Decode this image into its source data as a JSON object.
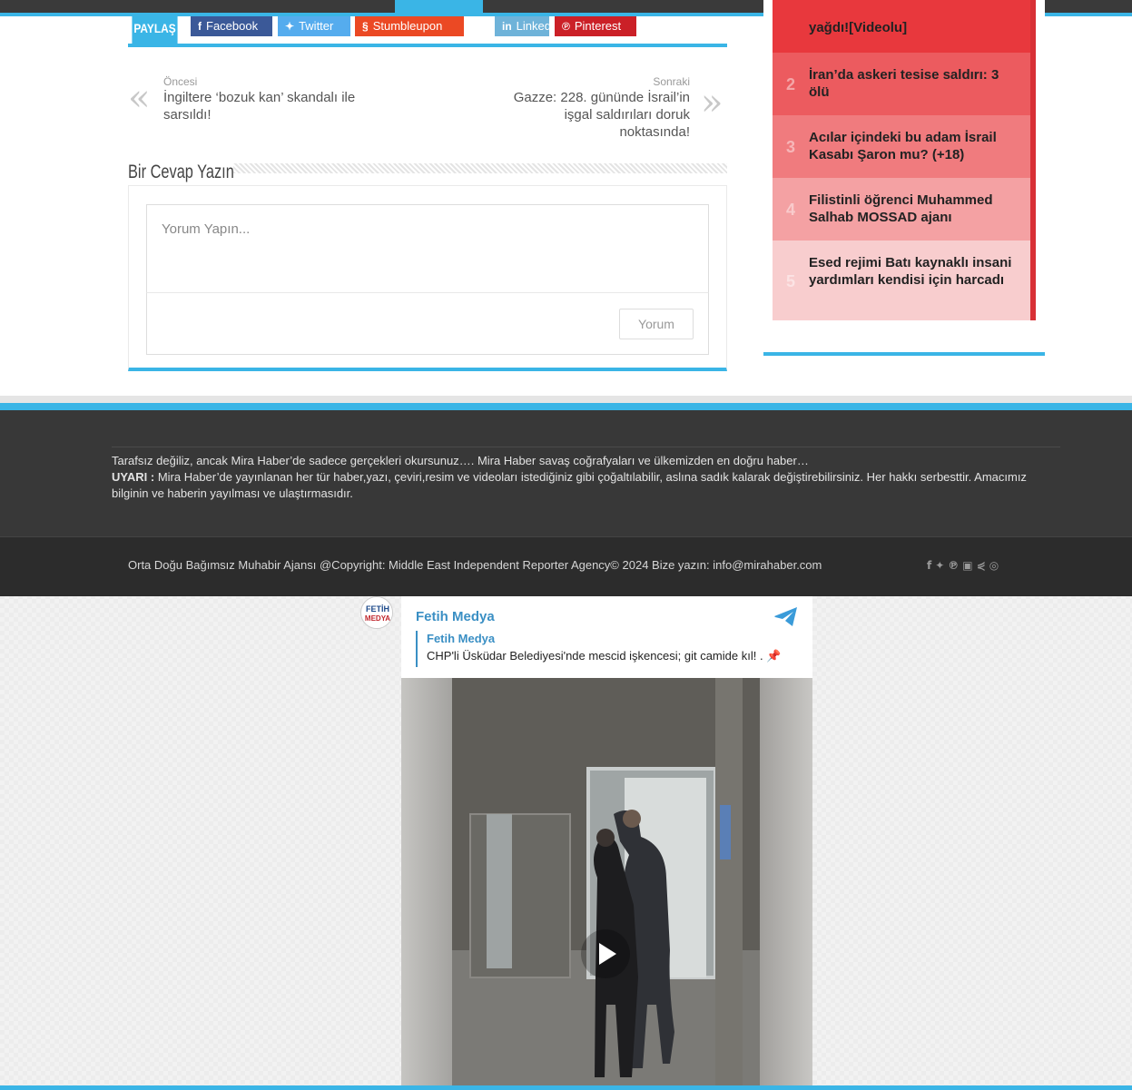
{
  "share": {
    "label": "PAYLAŞ",
    "buttons": [
      {
        "label": "Facebook",
        "icon": "facebook-icon",
        "glyph": "f",
        "color": "#3b5998"
      },
      {
        "label": "Twitter",
        "icon": "twitter-icon",
        "glyph": "✦",
        "color": "#55acee"
      },
      {
        "label": "Stumbleupon",
        "icon": "stumbleupon-icon",
        "glyph": "§",
        "color": "#eb4924"
      },
      {
        "label": "LinkedIn",
        "icon": "linkedin-icon",
        "glyph": "in",
        "color": "#6fb3d9"
      },
      {
        "label": "Pinterest",
        "icon": "pinterest-icon",
        "glyph": "℗",
        "color": "#cb2027"
      }
    ]
  },
  "post_nav": {
    "prev_label": "Öncesi",
    "prev_title": "İngiltere ‘bozuk kan’ skandalı ile sarsıldı!",
    "next_label": "Sonraki",
    "next_title": "Gazze: 228. gününde İsrail’in işgal saldırıları doruk noktasında!"
  },
  "reply": {
    "title": "Bir Cevap Yazın",
    "placeholder": "Yorum Yapın...",
    "submit": "Yorum"
  },
  "popular": [
    {
      "num": "",
      "title": "yağdı![Videolu]",
      "bg": "#e8383d"
    },
    {
      "num": "2",
      "title": "İran’da askeri tesise saldırı: 3 ölü",
      "bg": "#ec5b5f"
    },
    {
      "num": "3",
      "title": "Acılar içindeki bu adam İsrail Kasabı Şaron mu? (+18)",
      "bg": "#f07b7e"
    },
    {
      "num": "4",
      "title": "Filistinli öğrenci Muhammed Salhab MOSSAD ajanı",
      "bg": "#f4a1a3"
    },
    {
      "num": "5",
      "title": "Esed rejimi Batı kaynaklı insani yardımları kendisi için harcadı",
      "bg": "#f8cdce"
    }
  ],
  "footer": {
    "line1": "Tarafsız değiliz, ancak Mira Haber’de sadece gerçekleri okursunuz…. Mira Haber savaş coğrafyaları ve ülkemizden en doğru haber…",
    "warning_label": "UYARI :",
    "warning_text": " Mira Haber’de yayınlanan her tür haber,yazı, çeviri,resim ve videoları istediğiniz gibi çoğaltılabilir, aslına sadık kalarak değiştirebilirsiniz. Her hakkı serbesttir. Amacımız bilginin ve haberin yayılması ve ulaştırmasıdır.",
    "copyright": "Orta Doğu Bağımsız Muhabir Ajansı @Copyright: Middle East Independent Reporter Agency© 2024 Bize yazın: info@mirahaber.com",
    "social_icons": [
      "facebook-icon",
      "twitter-icon",
      "pinterest-icon",
      "youtube-icon",
      "share-icon",
      "instagram-icon"
    ]
  },
  "telegram": {
    "avatar_text": "FETİH MEDYA",
    "channel": "Fetih Medya",
    "quote_name": "Fetih Medya",
    "quote_text": "CHP'li Üsküdar Belediyesi'nde mescid işkencesi; git camide kıl! . 📌"
  }
}
